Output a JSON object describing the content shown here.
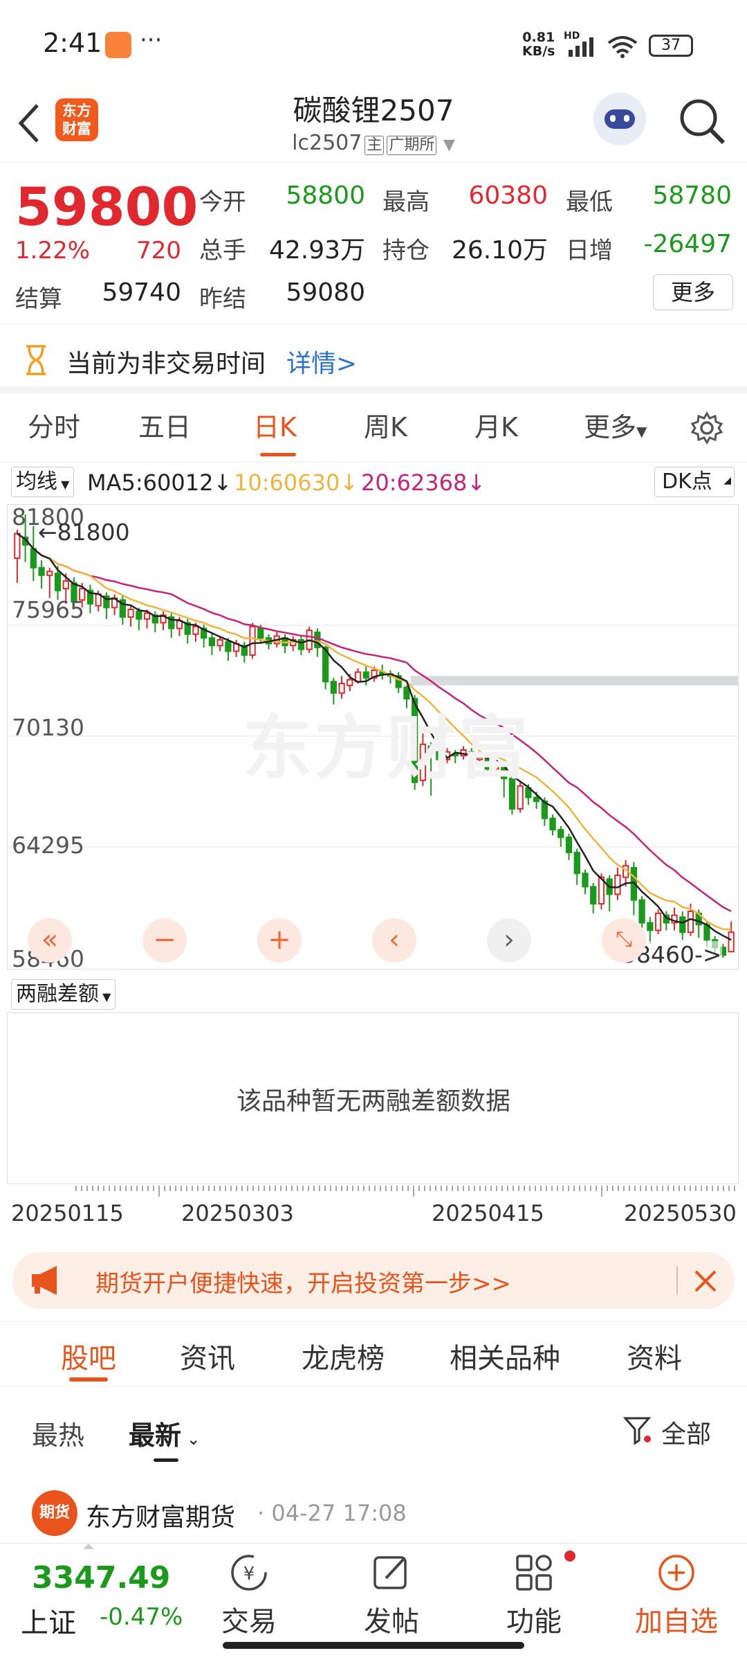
{
  "status": {
    "time": "2:41",
    "dots": "···",
    "net_speed_top": "0.81",
    "net_speed_unit": "KB/s",
    "hd": "HD",
    "battery": "37"
  },
  "nav": {
    "title": "碳酸锂2507",
    "code": "lc2507",
    "tag_main": "主",
    "tag_exchange": "广期所",
    "logo_line1": "东方",
    "logo_line2": "财富"
  },
  "quote": {
    "price": "59800",
    "change_pct": "1.22%",
    "change": "720",
    "open_label": "今开",
    "open": "58800",
    "high_label": "最高",
    "high": "60380",
    "low_label": "最低",
    "low": "58780",
    "volume_label": "总手",
    "volume": "42.93万",
    "oi_label": "持仓",
    "oi": "26.10万",
    "daily_inc_label": "日增",
    "daily_inc": "-26497",
    "settle_label": "结算",
    "settle": "59740",
    "prev_settle_label": "昨结",
    "prev_settle": "59080",
    "more_button": "更多"
  },
  "notice": {
    "text": "当前为非交易时间",
    "link": "详情>"
  },
  "chart_tabs": [
    "分时",
    "五日",
    "日K",
    "周K",
    "月K",
    "更多"
  ],
  "ma": {
    "selector": "均线",
    "ma5": "MA5:60012↓",
    "ma10": "10:60630↓",
    "ma20": "20:62368↓",
    "dk": "DK点"
  },
  "chart_data": {
    "type": "candlestick",
    "y_ticks": [
      "81800",
      "75965",
      "70130",
      "64295",
      "58460"
    ],
    "ylim": [
      58460,
      81800
    ],
    "max_label": "←81800",
    "min_label": "58460->",
    "watermark": "东方财富",
    "x_ticks": [
      "20250115",
      "20250303",
      "20250415",
      "20250530"
    ],
    "candles": [
      [
        79500,
        80800,
        78200,
        81000
      ],
      [
        80600,
        80200,
        79300,
        81800
      ],
      [
        80000,
        79000,
        78300,
        81200
      ],
      [
        79000,
        78600,
        77900,
        79400
      ],
      [
        78600,
        78800,
        77400,
        79000
      ],
      [
        78700,
        77800,
        77300,
        79100
      ],
      [
        77900,
        78300,
        77100,
        78700
      ],
      [
        78200,
        77200,
        76800,
        78500
      ],
      [
        77300,
        77900,
        76900,
        78200
      ],
      [
        77800,
        77100,
        76600,
        78100
      ],
      [
        77000,
        77600,
        76700,
        77800
      ],
      [
        77500,
        76900,
        76300,
        77700
      ],
      [
        76900,
        77400,
        76500,
        77600
      ],
      [
        77300,
        76400,
        76000,
        77500
      ],
      [
        76400,
        76800,
        75900,
        77000
      ],
      [
        76700,
        76300,
        75700,
        76900
      ],
      [
        76300,
        76600,
        75800,
        76800
      ],
      [
        76500,
        76100,
        75600,
        76700
      ],
      [
        76100,
        76500,
        75700,
        76700
      ],
      [
        76400,
        75800,
        75300,
        76600
      ],
      [
        75800,
        76200,
        75400,
        76400
      ],
      [
        76100,
        75500,
        75000,
        76300
      ],
      [
        75500,
        75900,
        75100,
        76100
      ],
      [
        75800,
        75300,
        74800,
        76000
      ],
      [
        75300,
        74900,
        74400,
        75600
      ],
      [
        74900,
        75200,
        74600,
        75400
      ],
      [
        75100,
        74600,
        74100,
        75300
      ],
      [
        74600,
        75000,
        74300,
        75200
      ],
      [
        74900,
        74400,
        74000,
        75100
      ],
      [
        74400,
        75900,
        74200,
        76100
      ],
      [
        75800,
        75300,
        75000,
        76000
      ],
      [
        75300,
        75000,
        74700,
        75500
      ],
      [
        75000,
        75400,
        74800,
        75600
      ],
      [
        75300,
        74900,
        74500,
        75500
      ],
      [
        74900,
        75200,
        74600,
        75400
      ],
      [
        75200,
        74700,
        74400,
        75400
      ],
      [
        74700,
        75700,
        74500,
        75900
      ],
      [
        75600,
        74800,
        74300,
        75800
      ],
      [
        74800,
        73000,
        72600,
        74900
      ],
      [
        73000,
        72400,
        71800,
        73200
      ],
      [
        72400,
        72900,
        72100,
        73300
      ],
      [
        72800,
        73100,
        72500,
        73400
      ],
      [
        73000,
        73500,
        72900,
        73700
      ],
      [
        73500,
        73200,
        72800,
        73800
      ],
      [
        73200,
        73600,
        73000,
        73800
      ],
      [
        73500,
        73400,
        73100,
        73900
      ],
      [
        73400,
        73300,
        72900,
        73600
      ],
      [
        73300,
        72700,
        72400,
        73500
      ],
      [
        72700,
        72100,
        71600,
        72800
      ],
      [
        72100,
        67700,
        67300,
        72300
      ],
      [
        67800,
        69700,
        67500,
        70500
      ],
      [
        69600,
        69300,
        67000,
        69800
      ],
      [
        69300,
        68900,
        68500,
        69500
      ],
      [
        68900,
        69300,
        68700,
        69500
      ],
      [
        69200,
        69100,
        68700,
        69400
      ],
      [
        69100,
        69400,
        68900,
        69600
      ],
      [
        69300,
        68900,
        68600,
        69500
      ],
      [
        68900,
        69000,
        68600,
        69200
      ],
      [
        69000,
        68400,
        68100,
        69200
      ],
      [
        68400,
        68600,
        68100,
        68800
      ],
      [
        68600,
        67900,
        66900,
        68700
      ],
      [
        67900,
        66300,
        66000,
        68000
      ],
      [
        66300,
        67500,
        66100,
        67700
      ],
      [
        67400,
        66900,
        66500,
        67600
      ],
      [
        66900,
        66700,
        66300,
        67200
      ],
      [
        66700,
        65800,
        65400,
        66900
      ],
      [
        65800,
        65200,
        64900,
        66000
      ],
      [
        65200,
        64800,
        64300,
        65400
      ],
      [
        64800,
        64000,
        63600,
        65000
      ],
      [
        64000,
        62900,
        62300,
        64200
      ],
      [
        62900,
        62200,
        61800,
        63100
      ],
      [
        62200,
        61300,
        60800,
        62400
      ],
      [
        61300,
        62700,
        61000,
        62900
      ],
      [
        62600,
        61800,
        60900,
        62800
      ],
      [
        61800,
        62800,
        61500,
        63200
      ],
      [
        62700,
        63300,
        62200,
        63600
      ],
      [
        63200,
        61500,
        60700,
        63500
      ],
      [
        61500,
        60300,
        59700,
        61700
      ],
      [
        60300,
        59900,
        59200,
        60600
      ],
      [
        59900,
        60800,
        59700,
        61000
      ],
      [
        60700,
        60300,
        59900,
        60900
      ],
      [
        60300,
        60700,
        59900,
        61100
      ],
      [
        60600,
        59800,
        59400,
        60900
      ],
      [
        59800,
        60900,
        59600,
        61300
      ],
      [
        60800,
        60200,
        59500,
        61000
      ],
      [
        60200,
        59400,
        59000,
        60400
      ],
      [
        59400,
        59000,
        58700,
        59600
      ],
      [
        59000,
        58600,
        58460,
        59200
      ],
      [
        58780,
        59800,
        58780,
        60380
      ]
    ]
  },
  "sub": {
    "selector": "两融差额",
    "empty": "该品种暂无两融差额数据"
  },
  "banner": {
    "text": "期货开户便捷快速，开启投资第一步>>"
  },
  "bottom_tabs": [
    "股吧",
    "资讯",
    "龙虎榜",
    "相关品种",
    "资料"
  ],
  "filters": {
    "hot": "最热",
    "new": "最新",
    "all": "全部"
  },
  "post": {
    "author": "东方财富期货",
    "time": "04-27 17:08",
    "avatar_text": "期货"
  },
  "bottom_nav": {
    "index_value": "3347.49",
    "index_name": "上证",
    "index_change": "-0.47%",
    "trade": "交易",
    "post": "发帖",
    "func": "功能",
    "add": "加自选"
  },
  "colors": {
    "up": "#e0282e",
    "down": "#1a9a1a",
    "accent": "#e8541c",
    "ma5": "#222222",
    "ma10": "#f0b43c",
    "ma20": "#c8237a"
  }
}
